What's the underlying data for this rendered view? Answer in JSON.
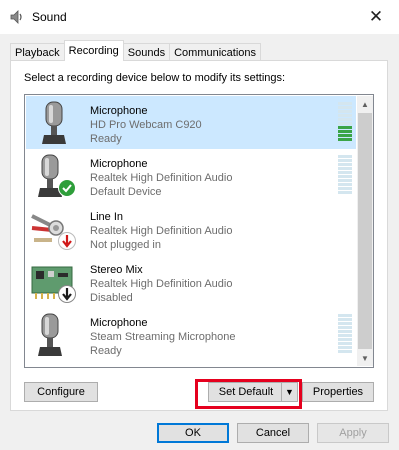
{
  "window": {
    "title": "Sound",
    "icon": "speaker-icon",
    "close_glyph": "✕"
  },
  "tabs": [
    {
      "label": "Playback",
      "active": false
    },
    {
      "label": "Recording",
      "active": true
    },
    {
      "label": "Sounds",
      "active": false
    },
    {
      "label": "Communications",
      "active": false
    }
  ],
  "instruction": "Select a recording device below to modify its settings:",
  "devices": [
    {
      "name": "Microphone",
      "description": "HD Pro Webcam C920",
      "status": "Ready",
      "selected": true,
      "icon": "microphone-icon",
      "badge": "",
      "level": 4
    },
    {
      "name": "Microphone",
      "description": "Realtek High Definition Audio",
      "status": "Default Device",
      "selected": false,
      "icon": "microphone-icon",
      "badge": "green-check-badge",
      "level": 0
    },
    {
      "name": "Line In",
      "description": "Realtek High Definition Audio",
      "status": "Not plugged in",
      "selected": false,
      "icon": "audio-jack-icon",
      "badge": "red-down-arrow-badge",
      "level": null
    },
    {
      "name": "Stereo Mix",
      "description": "Realtek High Definition Audio",
      "status": "Disabled",
      "selected": false,
      "icon": "sound-card-icon",
      "badge": "black-down-arrow-badge",
      "level": null
    },
    {
      "name": "Microphone",
      "description": "Steam Streaming Microphone",
      "status": "Ready",
      "selected": false,
      "icon": "microphone-icon",
      "badge": "",
      "level": 0
    }
  ],
  "scrollbar": {
    "up_glyph": "▲",
    "down_glyph": "▼"
  },
  "buttons": {
    "configure": "Configure",
    "set_default": "Set Default",
    "set_default_arrow": "▼",
    "properties": "Properties",
    "ok": "OK",
    "cancel": "Cancel",
    "apply": "Apply"
  },
  "colors": {
    "selection": "#cce8ff",
    "meter_active": "#3aa447",
    "highlight": "#e5001e",
    "accent": "#0078d7"
  }
}
